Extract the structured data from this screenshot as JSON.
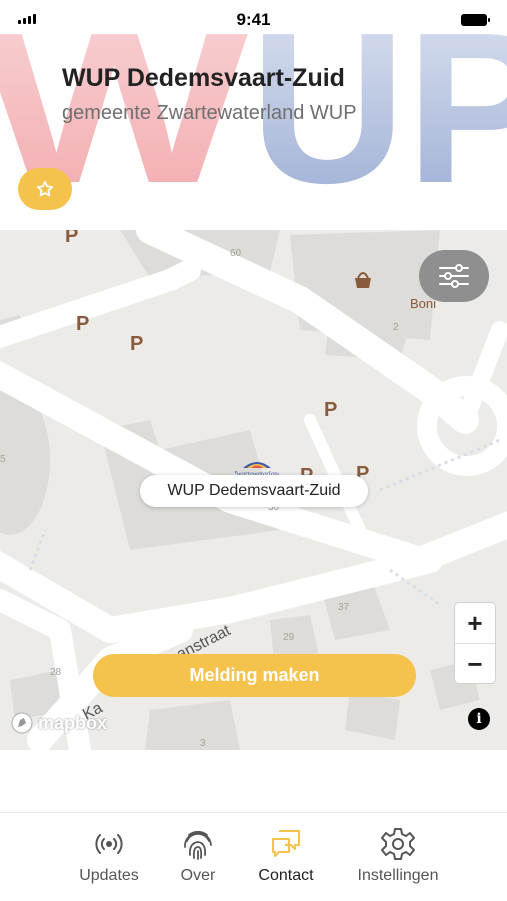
{
  "status_bar": {
    "time": "9:41"
  },
  "header": {
    "bg_text": "WUP",
    "title": "WUP Dedemsvaart-Zuid",
    "subtitle": "gemeente Zwartewaterland WUP"
  },
  "map": {
    "location_label": "WUP Dedemsvaart-Zuid",
    "marker_logo_text": "Zwartewaterland",
    "poi_name": "Boni",
    "street_name": "Karel Doormanstraat",
    "street_name_visible_start": "Ka",
    "street_name_visible_end": "anstraat",
    "parking_label": "P",
    "house_numbers": [
      "60",
      "2",
      "5",
      "30",
      "37",
      "29",
      "28",
      "3"
    ],
    "attribution": "mapbox",
    "zoom_in_label": "+",
    "zoom_out_label": "−",
    "info_label": "i",
    "action_button": "Melding maken"
  },
  "tabs": [
    {
      "label": "Updates",
      "icon": "broadcast-icon"
    },
    {
      "label": "Over",
      "icon": "fingerprint-icon"
    },
    {
      "label": "Contact",
      "icon": "chat-icon",
      "active": true
    },
    {
      "label": "Instellingen",
      "icon": "gear-icon"
    }
  ],
  "colors": {
    "accent": "#f5c24c",
    "bg_letter_red": "#f2a9ad",
    "bg_letter_blue": "#8fa3cf",
    "map_bg": "#ecebe8",
    "building": "#dedcd8",
    "parking": "#8a5a3c"
  }
}
